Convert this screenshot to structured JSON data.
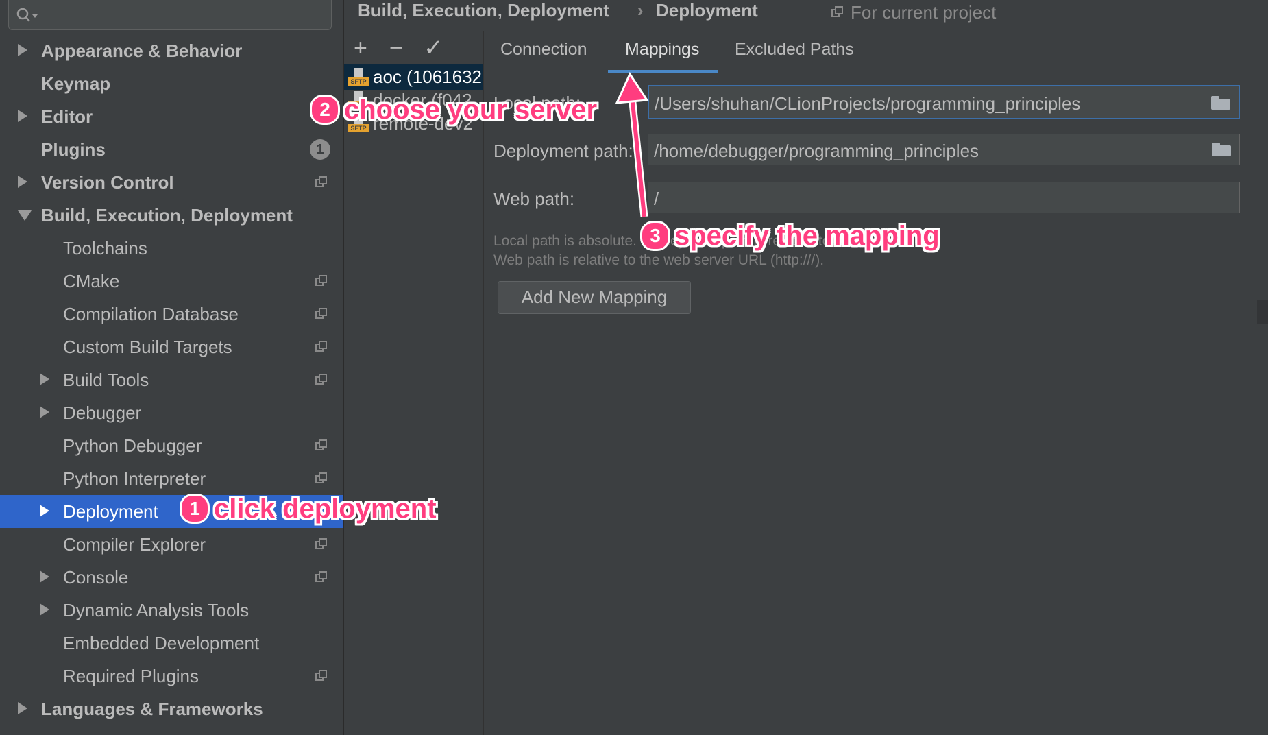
{
  "search": {
    "placeholder": ""
  },
  "sidebar": {
    "items": [
      {
        "label": "Appearance & Behavior",
        "level": 0,
        "arrow": "collapsed",
        "copy": false
      },
      {
        "label": "Keymap",
        "level": 0,
        "arrow": "none",
        "copy": false
      },
      {
        "label": "Editor",
        "level": 0,
        "arrow": "collapsed",
        "copy": false
      },
      {
        "label": "Plugins",
        "level": 0,
        "arrow": "none",
        "copy": false,
        "badge": "1"
      },
      {
        "label": "Version Control",
        "level": 0,
        "arrow": "collapsed",
        "copy": true
      },
      {
        "label": "Build, Execution, Deployment",
        "level": 0,
        "arrow": "expanded",
        "copy": false
      },
      {
        "label": "Toolchains",
        "level": 1,
        "arrow": "none",
        "copy": false
      },
      {
        "label": "CMake",
        "level": 1,
        "arrow": "none",
        "copy": true
      },
      {
        "label": "Compilation Database",
        "level": 1,
        "arrow": "none",
        "copy": true
      },
      {
        "label": "Custom Build Targets",
        "level": 1,
        "arrow": "none",
        "copy": true
      },
      {
        "label": "Build Tools",
        "level": 1,
        "arrow": "collapsed",
        "copy": true
      },
      {
        "label": "Debugger",
        "level": 1,
        "arrow": "collapsed",
        "copy": false
      },
      {
        "label": "Python Debugger",
        "level": 1,
        "arrow": "none",
        "copy": true
      },
      {
        "label": "Python Interpreter",
        "level": 1,
        "arrow": "none",
        "copy": true
      },
      {
        "label": "Deployment",
        "level": 1,
        "arrow": "collapsed",
        "copy": false,
        "selected": true
      },
      {
        "label": "Compiler Explorer",
        "level": 1,
        "arrow": "none",
        "copy": true
      },
      {
        "label": "Console",
        "level": 1,
        "arrow": "collapsed",
        "copy": true
      },
      {
        "label": "Dynamic Analysis Tools",
        "level": 1,
        "arrow": "collapsed",
        "copy": false
      },
      {
        "label": "Embedded Development",
        "level": 1,
        "arrow": "none",
        "copy": false
      },
      {
        "label": "Required Plugins",
        "level": 1,
        "arrow": "none",
        "copy": true
      },
      {
        "label": "Languages & Frameworks",
        "level": 0,
        "arrow": "collapsed",
        "copy": false
      }
    ]
  },
  "header": {
    "breadcrumb_parent": "Build, Execution, Deployment",
    "breadcrumb_sep": "›",
    "breadcrumb_current": "Deployment",
    "scope": "For current project"
  },
  "toolbar": {
    "add": "+",
    "remove": "−",
    "apply": "✓"
  },
  "servers": [
    {
      "name": "aoc (1061632",
      "tag": "SFTP",
      "selected": true
    },
    {
      "name": "docker (f042",
      "tag": "SFTP",
      "selected": false
    },
    {
      "name": "remote-dev2",
      "tag": "SFTP",
      "selected": false
    }
  ],
  "tabs": [
    {
      "label": "Connection",
      "active": false
    },
    {
      "label": "Mappings",
      "active": true
    },
    {
      "label": "Excluded Paths",
      "active": false
    }
  ],
  "form": {
    "local_path_label": "Local path:",
    "local_path_value": "/Users/shuhan/CLionProjects/programming_principles",
    "deployment_path_label": "Deployment path:",
    "deployment_path_value": "/home/debugger/programming_principles",
    "web_path_label": "Web path:",
    "web_path_value": "/",
    "help_line1": "Local path is absolute. Deployment path is relative to the root path (/).",
    "help_line2": "Web path is relative to the web server URL (http:///).",
    "add_mapping_label": "Add New Mapping"
  },
  "annotations": {
    "step1_num": "1",
    "step1_text": "click deployment",
    "step2_num": "2",
    "step2_text": "choose your server",
    "step3_num": "3",
    "step3_text": "specify the mapping"
  },
  "colors": {
    "accent": "#2f65ca",
    "annotation": "#ff3d7f",
    "tab_underline": "#4a88c7"
  }
}
